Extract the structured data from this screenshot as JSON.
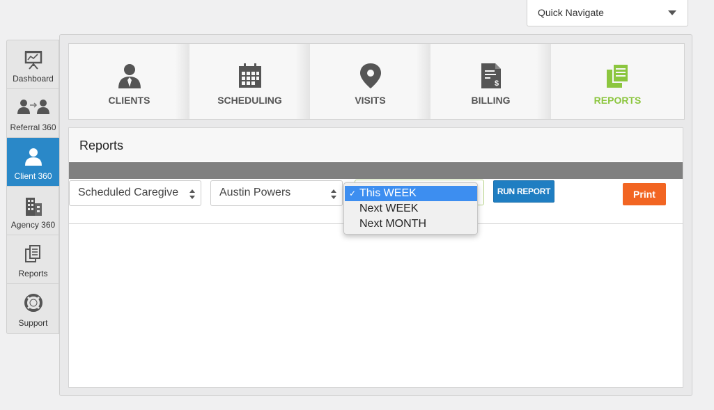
{
  "quick_nav": {
    "label": "Quick Navigate"
  },
  "sidebar": {
    "items": [
      {
        "label": "Dashboard",
        "icon": "presentation-icon"
      },
      {
        "label": "Referral 360",
        "icon": "referral-icon"
      },
      {
        "label": "Client 360",
        "icon": "user-icon",
        "active": true
      },
      {
        "label": "Agency 360",
        "icon": "building-icon"
      },
      {
        "label": "Reports",
        "icon": "documents-icon"
      },
      {
        "label": "Support",
        "icon": "lifebuoy-icon"
      }
    ]
  },
  "tabs": [
    {
      "label": "CLIENTS",
      "icon": "person-icon"
    },
    {
      "label": "SCHEDULING",
      "icon": "calendar-icon"
    },
    {
      "label": "VISITS",
      "icon": "map-pin-icon"
    },
    {
      "label": "BILLING",
      "icon": "invoice-icon"
    },
    {
      "label": "REPORTS",
      "icon": "reports-icon",
      "active": true
    }
  ],
  "panel": {
    "title": "Reports",
    "report_select": "Scheduled Caregive",
    "client_select": "Austin Powers",
    "run_label": "RUN REPORT",
    "print_label": "Print"
  },
  "period_dropdown": {
    "check": "✓",
    "options": [
      "This WEEK",
      "Next WEEK",
      "Next MONTH"
    ],
    "selected": "This WEEK"
  },
  "colors": {
    "active_sidebar": "#2a88c8",
    "active_tab": "#8cc63f",
    "run_button": "#1f7ec2",
    "print_button": "#f26522",
    "selected_option": "#3d8ef0"
  }
}
